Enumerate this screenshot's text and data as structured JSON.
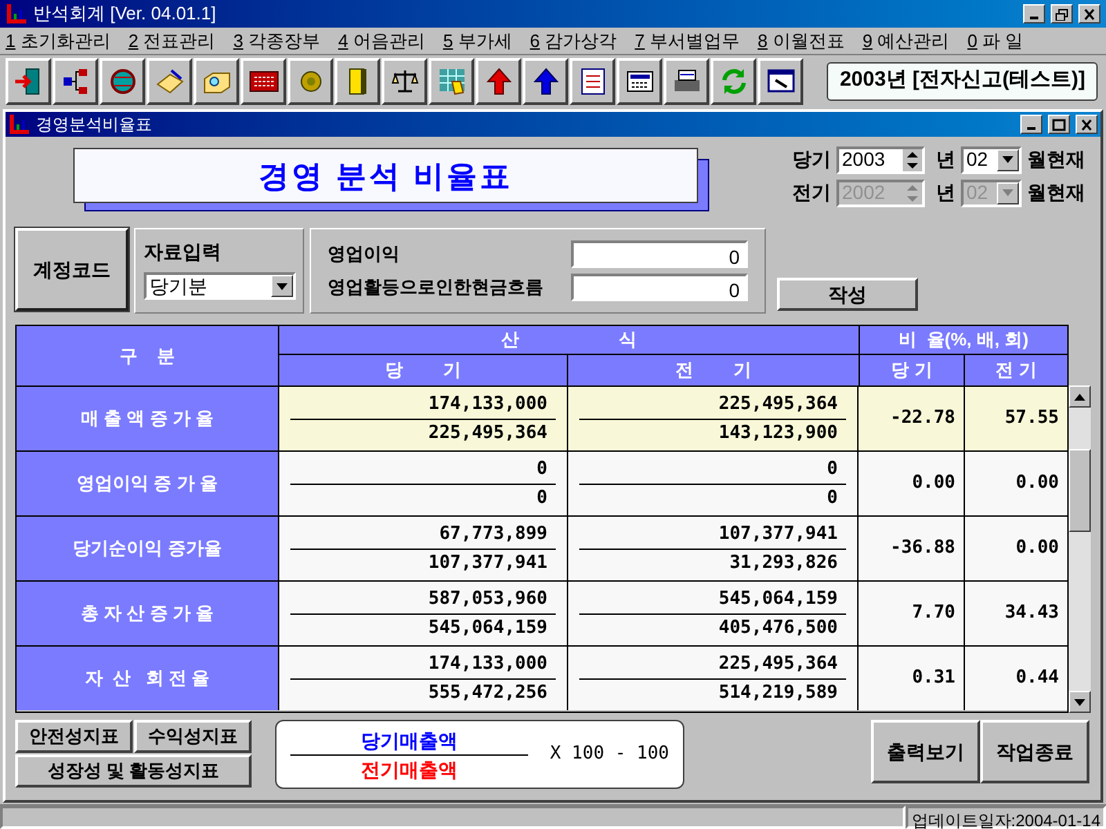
{
  "window": {
    "title": "반석회계 [Ver. 04.01.1]"
  },
  "menu": [
    {
      "key": "1",
      "label": "초기화관리"
    },
    {
      "key": "2",
      "label": "전표관리"
    },
    {
      "key": "3",
      "label": "각종장부"
    },
    {
      "key": "4",
      "label": "어음관리"
    },
    {
      "key": "5",
      "label": "부가세"
    },
    {
      "key": "6",
      "label": "감가상각"
    },
    {
      "key": "7",
      "label": "부서별업무"
    },
    {
      "key": "8",
      "label": "이월전표"
    },
    {
      "key": "9",
      "label": "예산관리"
    },
    {
      "key": "0",
      "label": "파 일"
    }
  ],
  "company_banner": "2003년  [전자신고(테스트)]",
  "child_window": {
    "title": "경영분석비율표"
  },
  "heading": "경영 분석 비율표",
  "periods": [
    {
      "label": "당기",
      "year": "2003",
      "year_unit": "년",
      "month": "02",
      "suffix": "월현재",
      "disabled": false
    },
    {
      "label": "전기",
      "year": "2002",
      "year_unit": "년",
      "month": "02",
      "suffix": "월현재",
      "disabled": true
    }
  ],
  "account_code_button": "계정코드",
  "data_input": {
    "label": "자료입력",
    "value": "당기분"
  },
  "inputs": [
    {
      "label": "영업이익",
      "value": "0"
    },
    {
      "label": "영업활등으로인한현금흐름",
      "value": "0"
    }
  ],
  "create_button": "작성",
  "table": {
    "header": {
      "category": "구    분",
      "formula": "산                    식",
      "ratio": "비  율(%, 배, 회)",
      "current": "당        기",
      "previous": "전        기",
      "ratio_current": "당 기",
      "ratio_previous": "전 기"
    },
    "rows": [
      {
        "label": "매 출 액 증 가 율",
        "cur_num": "174,133,000",
        "cur_den": "225,495,364",
        "prev_num": "225,495,364",
        "prev_den": "143,123,900",
        "ratio_cur": "-22.78",
        "ratio_prev": "57.55",
        "selected": true
      },
      {
        "label": "영업이익 증 가 율",
        "cur_num": "0",
        "cur_den": "0",
        "prev_num": "0",
        "prev_den": "0",
        "ratio_cur": "0.00",
        "ratio_prev": "0.00",
        "selected": false
      },
      {
        "label": "당기순이익 증가율",
        "cur_num": "67,773,899",
        "cur_den": "107,377,941",
        "prev_num": "107,377,941",
        "prev_den": "31,293,826",
        "ratio_cur": "-36.88",
        "ratio_prev": "0.00",
        "selected": false
      },
      {
        "label": "총 자 산 증 가 율",
        "cur_num": "587,053,960",
        "cur_den": "545,064,159",
        "prev_num": "545,064,159",
        "prev_den": "405,476,500",
        "ratio_cur": "7.70",
        "ratio_prev": "34.43",
        "selected": false
      },
      {
        "label": "자  산   회 전 율",
        "cur_num": "174,133,000",
        "cur_den": "555,472,256",
        "prev_num": "225,495,364",
        "prev_den": "514,219,589",
        "ratio_cur": "0.31",
        "ratio_prev": "0.44",
        "selected": false
      }
    ]
  },
  "indicator_buttons": [
    "안전성지표",
    "수익성지표",
    "성장성 및 활동성지표"
  ],
  "formula": {
    "numerator": "당기매출액",
    "denominator": "전기매출액",
    "operation": "X 100 - 100"
  },
  "action_buttons": [
    "출력보기",
    "작업종료"
  ],
  "status_bar": {
    "update_date": "업데이트일자:2004-01-14"
  }
}
